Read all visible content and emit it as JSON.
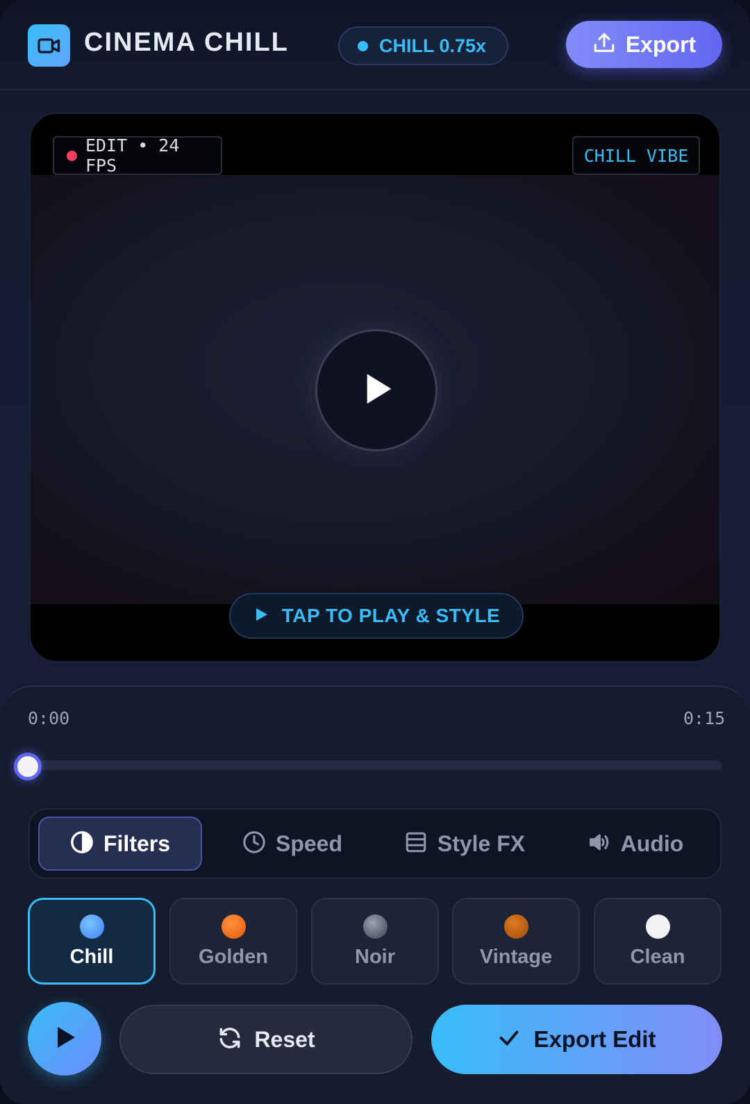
{
  "header": {
    "title": "CINEMA CHILL",
    "logo_icon": "video-camera-icon",
    "speed_badge": "CHILL 0.75x",
    "export_label": "Export",
    "export_icon": "upload-icon"
  },
  "video": {
    "edit_badge": "EDIT • 24 FPS",
    "vibe_badge": "CHILL VIBE",
    "play_icon": "play-icon",
    "tap_label": "TAP TO PLAY & STYLE"
  },
  "timeline": {
    "current_time": "0:00",
    "duration": "0:15",
    "progress": 0
  },
  "tabs": [
    {
      "label": "Filters",
      "icon": "contrast-icon",
      "active": true
    },
    {
      "label": "Speed",
      "icon": "clock-icon",
      "active": false
    },
    {
      "label": "Style FX",
      "icon": "layers-icon",
      "active": false
    },
    {
      "label": "Audio",
      "icon": "speaker-icon",
      "active": false
    }
  ],
  "filters": [
    {
      "label": "Chill",
      "color": "#60a5fa",
      "active": true
    },
    {
      "label": "Golden",
      "color": "#f97316",
      "active": false
    },
    {
      "label": "Noir",
      "color": "#6b7280",
      "active": false
    },
    {
      "label": "Vintage",
      "color": "#c2620e",
      "active": false
    },
    {
      "label": "Clean",
      "color": "#f1f2f4",
      "active": false
    }
  ],
  "actions": {
    "reset_label": "Reset",
    "export_edit_label": "Export Edit"
  },
  "colors": {
    "accent": "#38bdf8",
    "primary": "#6366f1",
    "record": "#f43f5e"
  }
}
